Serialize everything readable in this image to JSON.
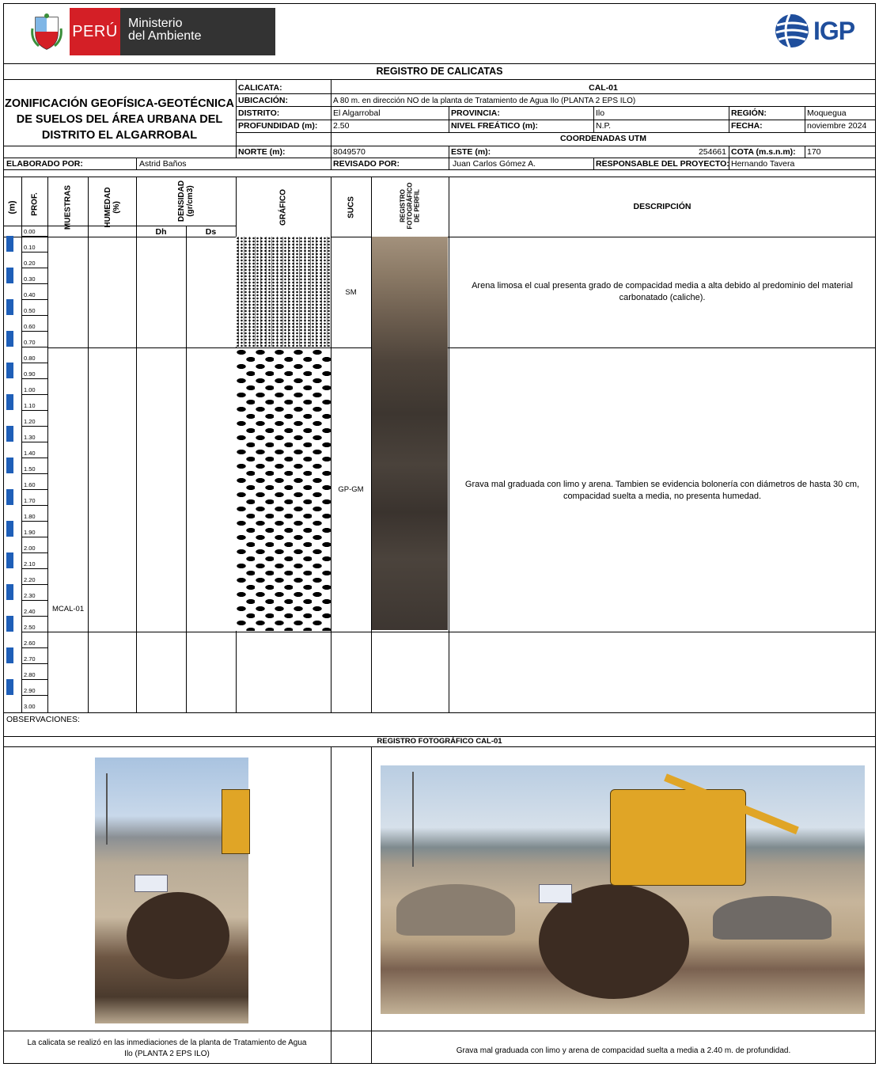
{
  "header": {
    "peru": "PERÚ",
    "ministry_line1": "Ministerio",
    "ministry_line2": "del Ambiente",
    "igp": "IGP"
  },
  "form": {
    "title": "REGISTRO DE CALICATAS",
    "project_title_l1": "ZONIFICACIÓN GEOFÍSICA-GEOTÉCNICA",
    "project_title_l2": "DE SUELOS DEL ÁREA URBANA DEL",
    "project_title_l3": "DISTRITO EL ALGARROBAL",
    "calicata_label": "CALICATA:",
    "calicata": "CAL-01",
    "ubicacion_label": "UBICACIÓN:",
    "ubicacion": "A 80 m. en dirección NO de la planta de Tratamiento de Agua Ilo (PLANTA 2 EPS ILO)",
    "distrito_label": "DISTRITO:",
    "distrito": "El Algarrobal",
    "provincia_label": "PROVINCIA:",
    "provincia": "Ilo",
    "region_label": "REGIÓN:",
    "region": "Moquegua",
    "profundidad_label": "PROFUNDIDAD (m):",
    "profundidad": "2.50",
    "nivel_label": "NIVEL FREÁTICO (m):",
    "nivel": "N.P.",
    "fecha_label": "FECHA:",
    "fecha": "noviembre 2024",
    "utm_label": "COORDENADAS UTM",
    "norte_label": "NORTE (m):",
    "norte": "8049570",
    "este_label": "ESTE (m):",
    "este": "254661",
    "cota_label": "COTA (m.s.n.m):",
    "cota": "170",
    "elaborado_label": "ELABORADO POR:",
    "elaborado": "Astrid Baños",
    "revisado_label": "REVISADO POR:",
    "revisado": "Juan Carlos Gómez A.",
    "responsable_label": "RESPONSABLE DEL PROYECTO:",
    "responsable": "Hernando Tavera"
  },
  "columns": {
    "m": "(m)",
    "prof": "PROF.",
    "muestras": "MUESTRAS",
    "humedad_l1": "HUMEDAD",
    "humedad_l2": "(%)",
    "densidad_l1": "DENSIDAD",
    "densidad_l2": "(gr/cm3)",
    "dh": "Dh",
    "ds": "Ds",
    "grafico": "GRÁFICO",
    "sucs": "SUCS",
    "registro_l1": "REGISTRO",
    "registro_l2": "FOTOGRÁFICO",
    "registro_l3": "DE PERFIL",
    "descripcion": "DESCRIPCIÓN"
  },
  "depths": [
    "0.00",
    "0.10",
    "0.20",
    "0.30",
    "0.40",
    "0.50",
    "0.60",
    "0.70",
    "0.80",
    "0.90",
    "1.00",
    "1.10",
    "1.20",
    "1.30",
    "1.40",
    "1.50",
    "1.60",
    "1.70",
    "1.80",
    "1.90",
    "2.00",
    "2.10",
    "2.20",
    "2.30",
    "2.40",
    "2.50",
    "2.60",
    "2.70",
    "2.80",
    "2.90",
    "3.00"
  ],
  "layers": [
    {
      "sucs": "SM",
      "desc_l1": "Arena limosa el cual presenta grado de compacidad media a alta debido al predominio del  material",
      "desc_l2": "carbonatado (caliche)."
    },
    {
      "sucs": "GP-GM",
      "desc_l1": "Grava mal graduada con limo y arena. Tambien se evidencia bolonería con diámetros de hasta 30 cm,",
      "desc_l2": "compacidad suelta a media, no presenta humedad."
    }
  ],
  "sample": "MCAL-01",
  "observaciones_label": "OBSERVACIONES:",
  "photo_section": {
    "title": "REGISTRO FOTOGRÁFICO CAL-01",
    "caption_left_l1": "La calicata se realizó en las inmediaciones de la planta de Tratamiento de Agua",
    "caption_left_l2": "Ilo (PLANTA 2 EPS ILO)",
    "caption_right": "Grava mal graduada con limo y arena de compacidad suelta a media a 2.40 m. de profundidad."
  }
}
